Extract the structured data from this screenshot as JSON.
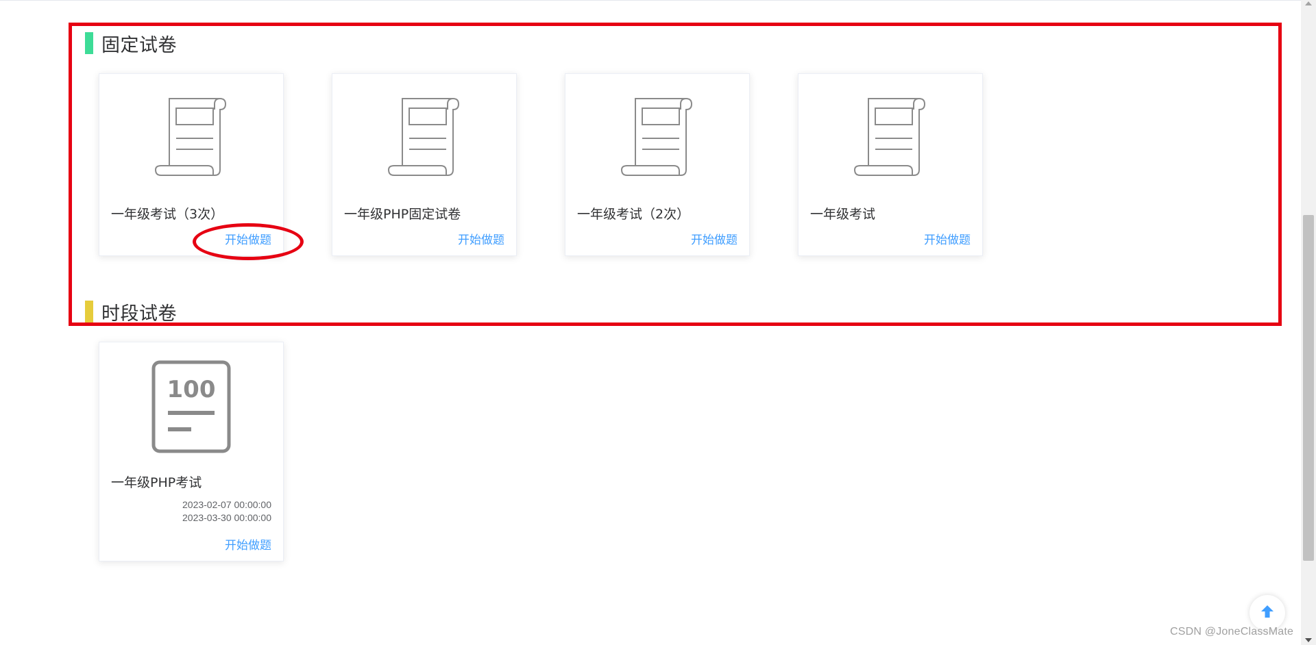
{
  "sections": [
    {
      "title": "固定试卷",
      "accent": "#3ddc97",
      "papers": [
        {
          "title": "一年级考试（3次）",
          "action": "开始做题"
        },
        {
          "title": "一年级PHP固定试卷",
          "action": "开始做题"
        },
        {
          "title": "一年级考试（2次）",
          "action": "开始做题"
        },
        {
          "title": "一年级考试",
          "action": "开始做题"
        }
      ]
    },
    {
      "title": "时段试卷",
      "accent": "#e6cc3b",
      "papers": [
        {
          "title": "一年级PHP考试",
          "icon_text": "100",
          "start_time": "2023-02-07 00:00:00",
          "end_time": "2023-03-30 00:00:00",
          "action": "开始做题"
        }
      ]
    }
  ],
  "icons": {
    "fixed_paper": "scroll-document-icon",
    "timed_paper": "score-sheet-icon",
    "back_to_top": "arrow-up-icon"
  },
  "colors": {
    "link": "#409eff",
    "annotation": "#e60012",
    "icon_stroke": "#8a8a8a"
  },
  "watermark": "CSDN @JoneClassMate"
}
